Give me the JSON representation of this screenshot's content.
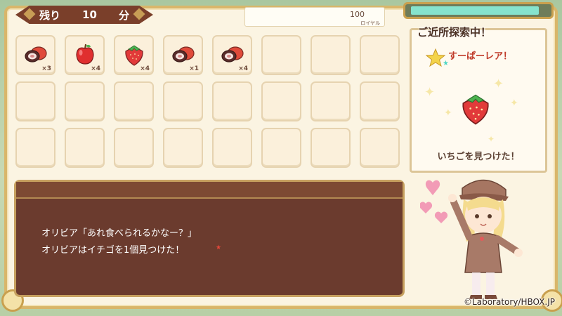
{
  "hud": {
    "timer_prefix": "残り",
    "timer_value": "10",
    "timer_unit": "分",
    "royal_value": "100",
    "royal_unit": "ロイヤル",
    "gauge_level": 0.93,
    "gauge_color": "#86e3cd"
  },
  "inventory": {
    "slots": [
      {
        "item": "meat-icon",
        "count": "×3"
      },
      {
        "item": "apple-icon",
        "count": "×4"
      },
      {
        "item": "strawberry-icon",
        "count": "×4"
      },
      {
        "item": "meat-icon",
        "count": "×1"
      },
      {
        "item": "meat-icon",
        "count": "×4"
      },
      {
        "item": "",
        "count": ""
      },
      {
        "item": "",
        "count": ""
      },
      {
        "item": "",
        "count": ""
      },
      {
        "item": "",
        "count": ""
      },
      {
        "item": "",
        "count": ""
      },
      {
        "item": "",
        "count": ""
      },
      {
        "item": "",
        "count": ""
      },
      {
        "item": "",
        "count": ""
      },
      {
        "item": "",
        "count": ""
      },
      {
        "item": "",
        "count": ""
      },
      {
        "item": "",
        "count": ""
      },
      {
        "item": "",
        "count": ""
      },
      {
        "item": "",
        "count": ""
      },
      {
        "item": "",
        "count": ""
      },
      {
        "item": "",
        "count": ""
      },
      {
        "item": "",
        "count": ""
      },
      {
        "item": "",
        "count": ""
      },
      {
        "item": "",
        "count": ""
      },
      {
        "item": "",
        "count": ""
      }
    ]
  },
  "search_panel": {
    "title": "ご近所探索中！",
    "rarity": "すーぱーレア！",
    "found_item": "strawberry-icon",
    "found_text": "いちごを見つけた！"
  },
  "dialog": {
    "line1": "オリビア「あれ食べられるかなー？」",
    "line2": "オリビアはイチゴを1個見つけた！"
  },
  "footer": {
    "copyright": "©Laboratory/HBOX.JP"
  },
  "colors": {
    "dialog_bg": "#6b3b2e",
    "frame": "#d9b66a",
    "accent_red": "#c03b2a"
  }
}
